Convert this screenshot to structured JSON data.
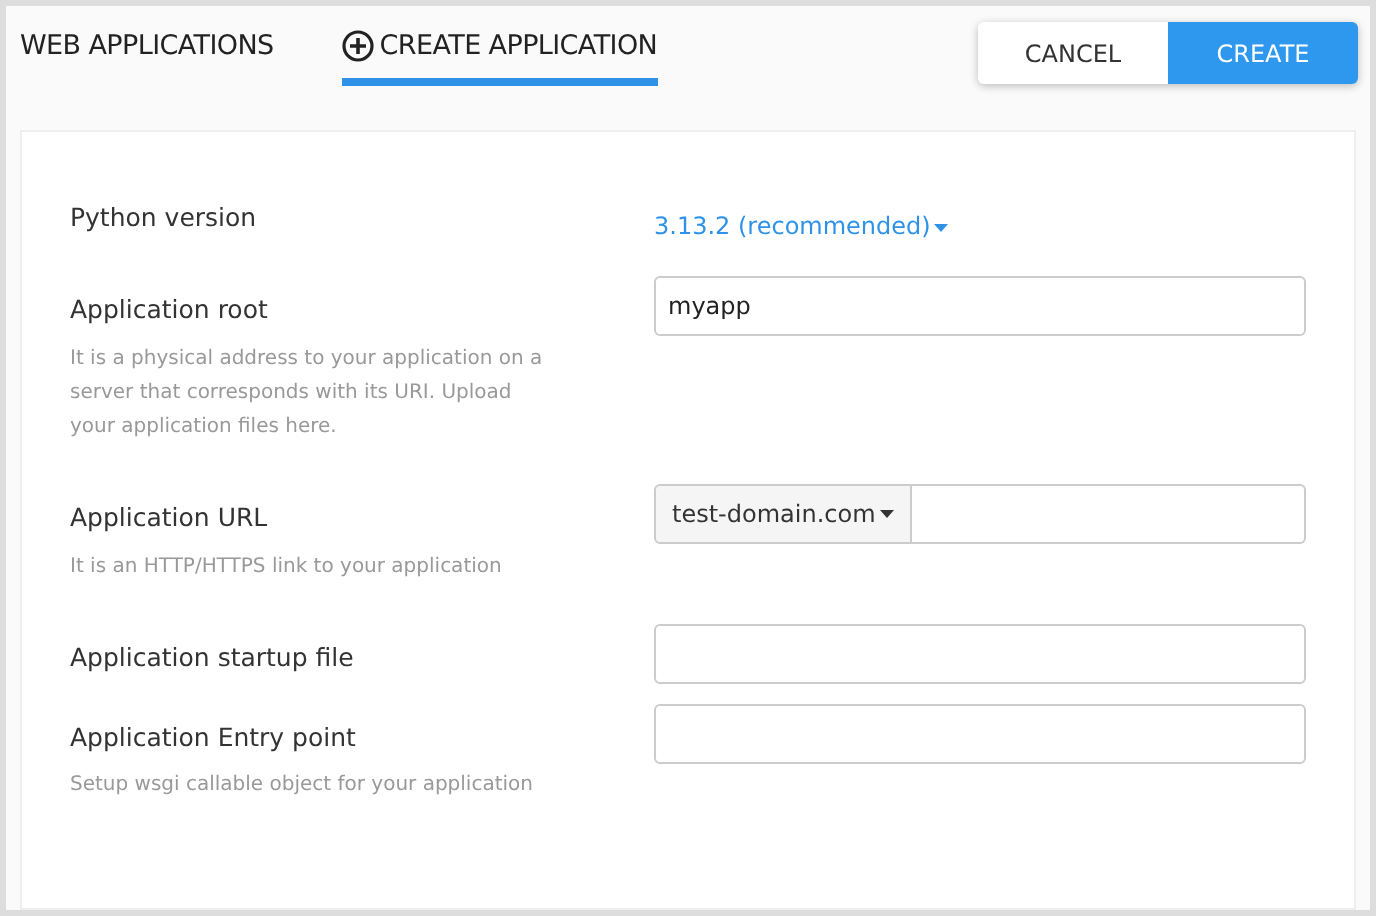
{
  "tabs": [
    {
      "label": "WEB APPLICATIONS",
      "selected": false,
      "icon": false
    },
    {
      "label": "CREATE APPLICATION",
      "selected": true,
      "icon": true
    }
  ],
  "buttons": [
    {
      "label": "CANCEL",
      "kind": "secondary"
    },
    {
      "label": "CREATE",
      "kind": "primary"
    }
  ],
  "fields": [
    {
      "kind": "select",
      "label": "Python version",
      "value": "3.13.2 (recommended)"
    },
    {
      "kind": "text",
      "label": "Application root",
      "value": "myapp",
      "description": "It is a physical address to your application on a server that corresponds with its URI. Upload your application files here."
    },
    {
      "kind": "url",
      "label": "Application URL",
      "domain": "test-domain.com",
      "description": "It is an HTTP/HTTPS link to your application"
    },
    {
      "kind": "text",
      "label": "Application startup file"
    },
    {
      "kind": "text",
      "label": "Application Entry point",
      "description": "Setup wsgi callable object for your application"
    }
  ]
}
